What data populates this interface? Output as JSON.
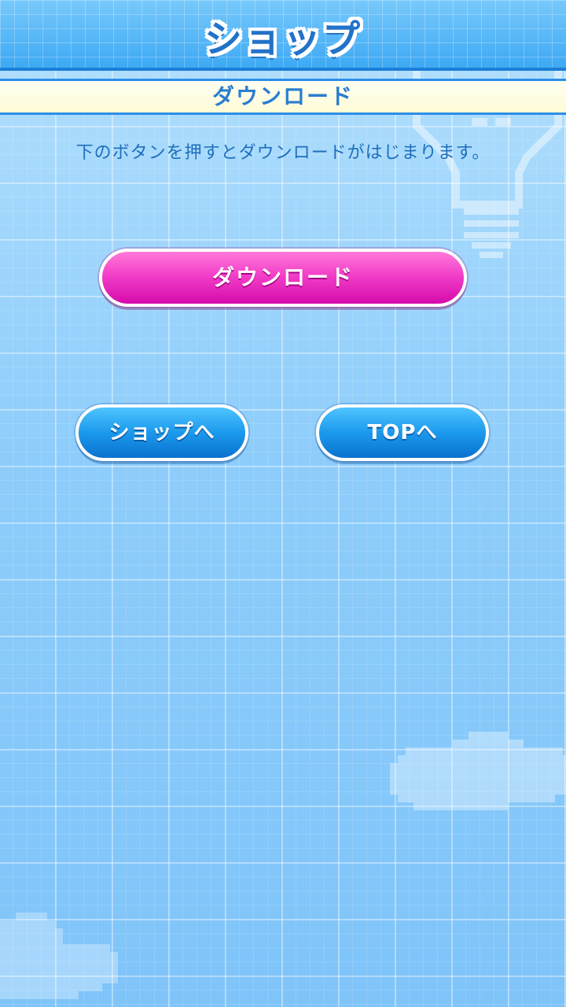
{
  "header": {
    "title": "ショップ"
  },
  "section": {
    "title": "ダウンロード"
  },
  "instruction": "下のボタンを押すとダウンロードがはじまります。",
  "buttons": {
    "download_label": "ダウンロード",
    "shop_label": "ショップへ",
    "top_label": "TOPへ"
  },
  "colors": {
    "download_button": "#f23fc9",
    "nav_button": "#1b99ec",
    "header": "#3da9f4",
    "banner": "#fdfbd6"
  },
  "icons": {
    "bulb": "lightbulb-icon",
    "cloud": "cloud-icon"
  }
}
